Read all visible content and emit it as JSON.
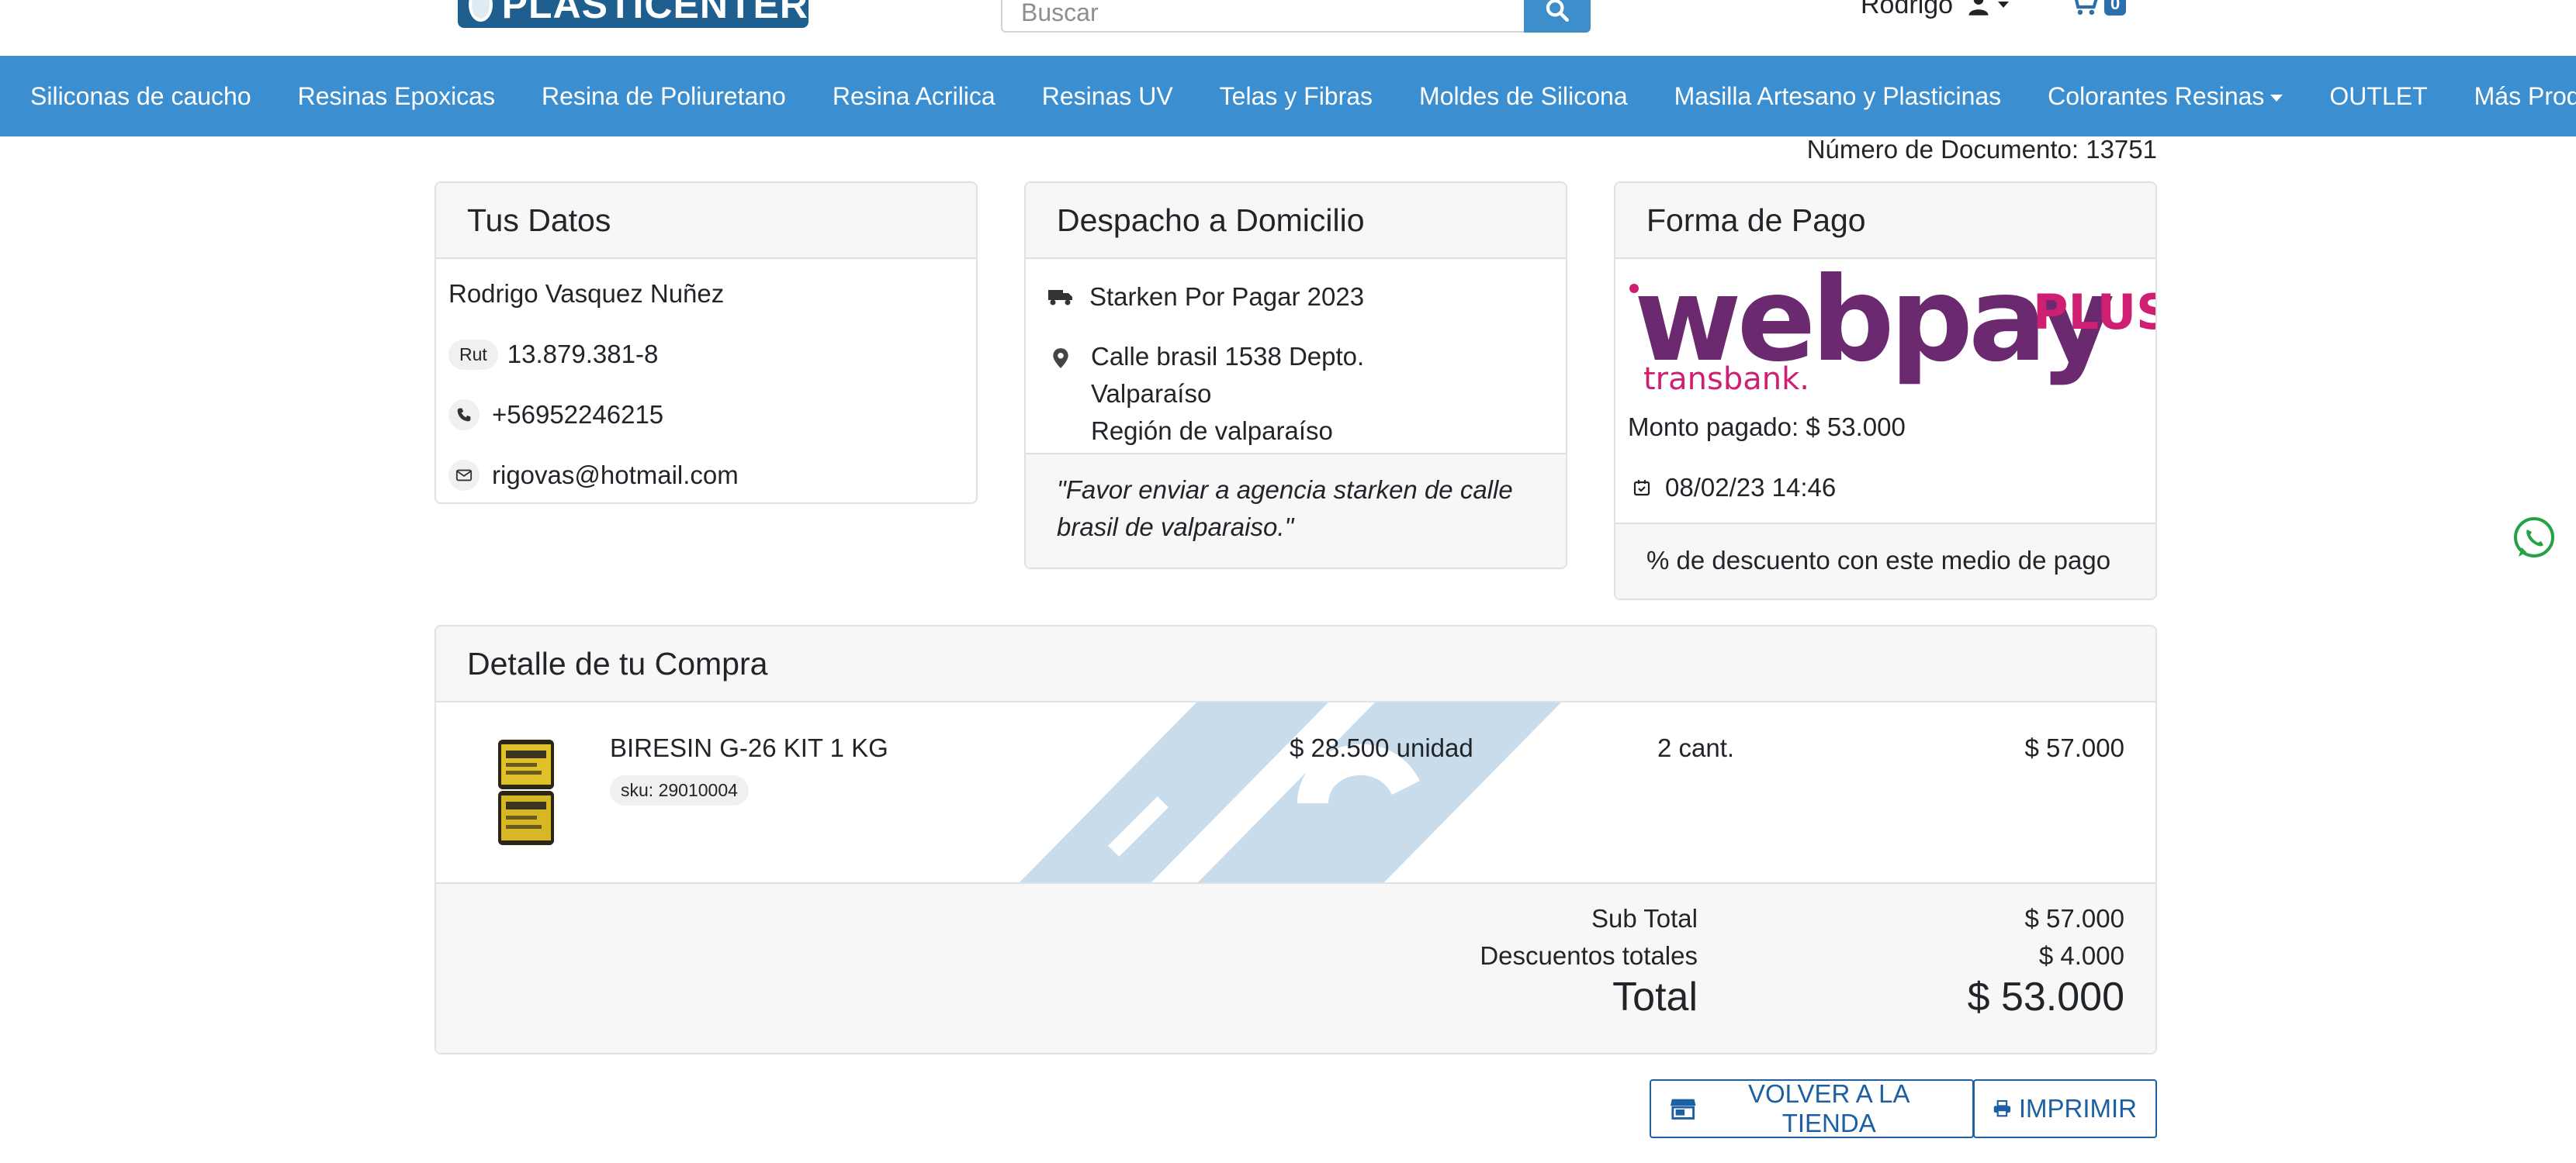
{
  "header": {
    "logo_text": "PLASTICENTER",
    "search_placeholder": "Buscar",
    "user_name": "Rodrigo",
    "cart_count": "0"
  },
  "nav": {
    "items": [
      {
        "label": "Siliconas de caucho"
      },
      {
        "label": "Resinas Epoxicas"
      },
      {
        "label": "Resina de Poliuretano"
      },
      {
        "label": "Resina Acrilica"
      },
      {
        "label": "Resinas UV"
      },
      {
        "label": "Telas y Fibras"
      },
      {
        "label": "Moldes de Silicona"
      },
      {
        "label": "Masilla Artesano y Plasticinas"
      },
      {
        "label": "Colorantes Resinas"
      },
      {
        "label": "OUTLET"
      },
      {
        "label": "Más Productos"
      }
    ]
  },
  "document": {
    "number_label": "Número de Documento: 13751"
  },
  "datos": {
    "title": "Tus Datos",
    "name": "Rodrigo Vasquez Nuñez",
    "rut_label": "Rut",
    "rut": "13.879.381-8",
    "phone": "+56952246215",
    "email": "rigovas@hotmail.com"
  },
  "despacho": {
    "title": "Despacho a Domicilio",
    "carrier": "Starken Por Pagar 2023",
    "address_line1": "Calle brasil 1538 Depto.",
    "address_line2": "Valparaíso",
    "address_line3": "Región de valparaíso",
    "note": "\"Favor enviar a agencia starken de calle brasil de valparaiso.\""
  },
  "pago": {
    "title": "Forma de Pago",
    "logo_main": "webpay",
    "logo_plus": "PLUS",
    "logo_sub": "transbank.",
    "amount": "Monto pagado: $ 53.000",
    "date": "08/02/23 14:46",
    "discount_note": "% de descuento con este medio de pago"
  },
  "detalle": {
    "title": "Detalle de tu Compra",
    "items": [
      {
        "name": "BIRESIN G-26 KIT 1 KG",
        "sku": "sku: 29010004",
        "unit_price": "$ 28.500 unidad",
        "qty": "2 cant.",
        "total": "$ 57.000"
      }
    ],
    "subtotal_label": "Sub Total",
    "subtotal": "$ 57.000",
    "discount_label": "Descuentos totales",
    "discount": "$ 4.000",
    "total_label": "Total",
    "total": "$ 53.000"
  },
  "actions": {
    "back_label": "VOLVER A LA TIENDA",
    "print_label": "IMPRIMIR"
  },
  "colors": {
    "navbar": "#3b8fd0",
    "accent_button": "#1d5fa3",
    "webpay_purple": "#6b2a6f",
    "webpay_pink": "#cf1f73"
  }
}
